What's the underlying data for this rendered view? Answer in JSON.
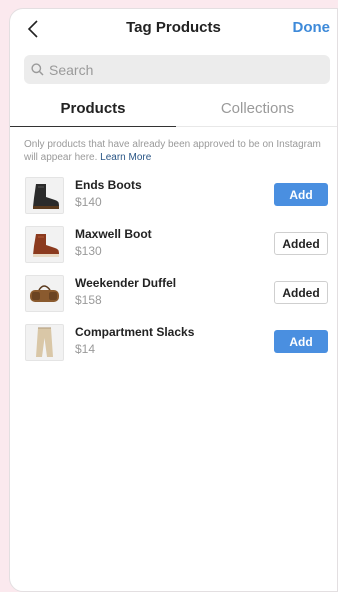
{
  "navbar": {
    "title": "Tag Products",
    "done_label": "Done",
    "back_icon": "chevron-left-icon"
  },
  "search": {
    "placeholder": "Search",
    "icon": "search-icon"
  },
  "tabs": [
    {
      "label": "Products",
      "active": true
    },
    {
      "label": "Collections",
      "active": false
    }
  ],
  "notice": {
    "text": "Only products that have already been approved to be on Instagram will appear here.",
    "link": "Learn More"
  },
  "products": [
    {
      "name": "Ends Boots",
      "price": "$140",
      "action": "Add",
      "state": "add",
      "image": "boot-icon"
    },
    {
      "name": "Maxwell Boot",
      "price": "$130",
      "action": "Added",
      "state": "added",
      "image": "boot-icon"
    },
    {
      "name": "Weekender Duffel",
      "price": "$158",
      "action": "Added",
      "state": "added",
      "image": "duffel-bag-icon"
    },
    {
      "name": "Compartment Slacks",
      "price": "$14",
      "action": "Add",
      "state": "add",
      "image": "pants-icon"
    }
  ],
  "colors": {
    "accent": "#4a8fe0",
    "done": "#3e8ad9",
    "background": "#fbe9ee",
    "link": "#2a5686"
  }
}
